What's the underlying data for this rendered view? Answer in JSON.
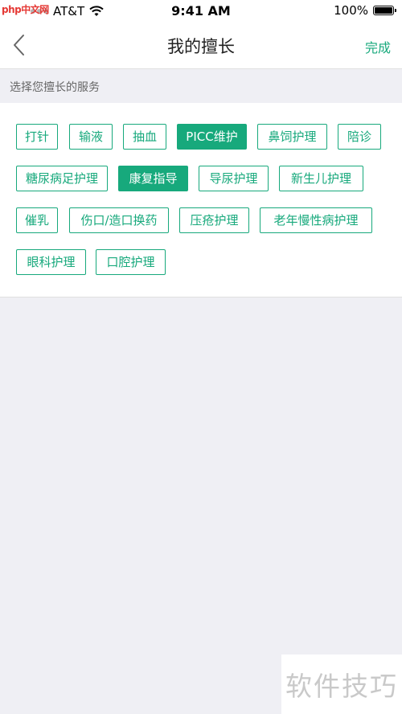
{
  "status_bar": {
    "carrier": "AT&T",
    "time": "9:41 AM",
    "battery_percent": "100%",
    "watermark": "php中文网"
  },
  "nav": {
    "title": "我的擅长",
    "done_label": "完成"
  },
  "section": {
    "header": "选择您擅长的服务"
  },
  "tags": [
    {
      "label": "打针",
      "selected": false
    },
    {
      "label": "输液",
      "selected": false
    },
    {
      "label": "抽血",
      "selected": false
    },
    {
      "label": "PICC维护",
      "selected": true
    },
    {
      "label": "鼻饲护理",
      "selected": false
    },
    {
      "label": "陪诊",
      "selected": false
    },
    {
      "label": "糖尿病足护理",
      "selected": false
    },
    {
      "label": "康复指导",
      "selected": true
    },
    {
      "label": "导尿护理",
      "selected": false
    },
    {
      "label": "新生儿护理",
      "selected": false
    },
    {
      "label": "催乳",
      "selected": false
    },
    {
      "label": "伤口/造口换药",
      "selected": false
    },
    {
      "label": "压疮护理",
      "selected": false
    },
    {
      "label": "老年慢性病护理",
      "selected": false
    },
    {
      "label": "眼科护理",
      "selected": false
    },
    {
      "label": "口腔护理",
      "selected": false
    }
  ],
  "colors": {
    "accent": "#17a97c",
    "background": "#efeff4"
  },
  "watermark_corner": "软件技巧"
}
